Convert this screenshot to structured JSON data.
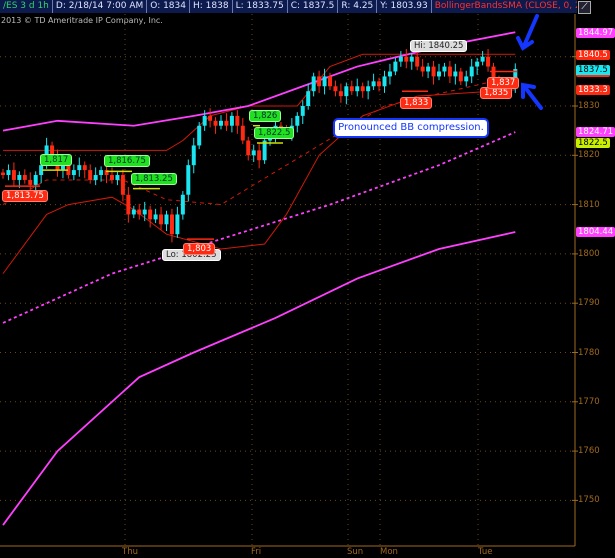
{
  "header": {
    "symbol": "/ES 3 d 1h",
    "date": "D: 2/18/14 7:00 AM",
    "open": "O: 1834",
    "high": "H: 1838",
    "low": "L: 1833.75",
    "close": "C: 1837.5",
    "range": "R: 4.25",
    "y": "Y: 1803.93",
    "study": "BollingerBandsSMA (CLOSE, 0, 25, -2.0, ..."
  },
  "copyright": "2013 © TD Ameritrade IP Company, Inc.",
  "callout": "Pronounced BB compression.",
  "annotations": {
    "a1": "1,813.75",
    "a2": "1,817",
    "a3": "1,816.75",
    "a4": "1,813.25",
    "a5": "1,803",
    "a6": "Lo: 1802.25",
    "a7": "1,826",
    "a8": "1,822.5",
    "a9": "Hi: 1840.25",
    "a10": "1,833",
    "a11": "1,837",
    "a12": "1,835"
  },
  "axis_labels": {
    "m1": "1844.97",
    "r1": "1840.5",
    "c1": "1837.5",
    "r2": "1833.3",
    "m2": "1824.71",
    "y1": "1822.5",
    "m3": "1804.44"
  },
  "ticks": [
    "1830",
    "1820",
    "1810",
    "1800",
    "1790",
    "1780",
    "1770",
    "1760",
    "1750"
  ],
  "days": [
    "Thu",
    "Fri",
    "Sun",
    "Mon",
    "Tue"
  ],
  "colors": {
    "up": "#19e6f0",
    "down": "#ff2a12",
    "bb": "#d01a0a",
    "sma": "#ff40ff",
    "grid": "#6a4a10",
    "axis": "#a06a20"
  },
  "chart_data": {
    "type": "candlestick",
    "closes": [
      1816,
      1817,
      1815,
      1816,
      1815,
      1814,
      1816,
      1818,
      1822,
      1820,
      1817,
      1818,
      1816,
      1817,
      1818,
      1817,
      1815,
      1816,
      1817,
      1816,
      1815,
      1816,
      1812,
      1808,
      1809,
      1808,
      1809,
      1807,
      1808,
      1806,
      1808,
      1804,
      1808,
      1812,
      1818,
      1822,
      1826,
      1828,
      1827,
      1826,
      1827,
      1826,
      1828,
      1826,
      1823,
      1820,
      1821,
      1819,
      1823,
      1824,
      1826,
      1825,
      1824,
      1826,
      1828,
      1830,
      1833,
      1836,
      1834,
      1836,
      1834,
      1833,
      1832,
      1834,
      1833,
      1834,
      1833,
      1834,
      1835,
      1834,
      1836,
      1837,
      1839,
      1840,
      1839,
      1840,
      1838,
      1837,
      1838,
      1836,
      1837,
      1838,
      1836,
      1837,
      1835,
      1836,
      1838,
      1839,
      1840,
      1838,
      1835,
      1834,
      1833,
      1834,
      1837.5
    ],
    "bb_upper": [
      [
        0,
        1821
      ],
      [
        30,
        1821
      ],
      [
        33,
        1823
      ],
      [
        38,
        1828
      ],
      [
        45,
        1830
      ],
      [
        54,
        1830
      ],
      [
        60,
        1838
      ],
      [
        66,
        1840.5
      ],
      [
        94,
        1840.5
      ]
    ],
    "bb_mid": [
      [
        0,
        1810
      ],
      [
        8,
        1815
      ],
      [
        22,
        1815
      ],
      [
        30,
        1811
      ],
      [
        40,
        1810
      ],
      [
        55,
        1820
      ],
      [
        70,
        1830
      ],
      [
        94,
        1836
      ]
    ],
    "bb_lower": [
      [
        0,
        1796
      ],
      [
        8,
        1808
      ],
      [
        12,
        1810
      ],
      [
        20,
        1811.5
      ],
      [
        24,
        1809
      ],
      [
        30,
        1804
      ],
      [
        40,
        1801
      ],
      [
        48,
        1802
      ],
      [
        52,
        1808
      ],
      [
        58,
        1820
      ],
      [
        66,
        1828
      ],
      [
        76,
        1832
      ],
      [
        94,
        1833.3
      ]
    ],
    "sma_fast": [
      [
        0,
        1825
      ],
      [
        10,
        1827
      ],
      [
        24,
        1826
      ],
      [
        35,
        1828
      ],
      [
        45,
        1830
      ],
      [
        55,
        1834
      ],
      [
        65,
        1838
      ],
      [
        80,
        1842
      ],
      [
        94,
        1844.97
      ]
    ],
    "sma_mid_dashed": [
      [
        0,
        1786
      ],
      [
        20,
        1796
      ],
      [
        40,
        1803
      ],
      [
        60,
        1810
      ],
      [
        80,
        1818
      ],
      [
        94,
        1824.71
      ]
    ],
    "sma_slow": [
      [
        0,
        1745
      ],
      [
        10,
        1760
      ],
      [
        25,
        1775
      ],
      [
        35,
        1780
      ],
      [
        50,
        1787
      ],
      [
        65,
        1795
      ],
      [
        80,
        1801
      ],
      [
        94,
        1804.44
      ]
    ],
    "ylim": [
      1745,
      1850
    ]
  }
}
